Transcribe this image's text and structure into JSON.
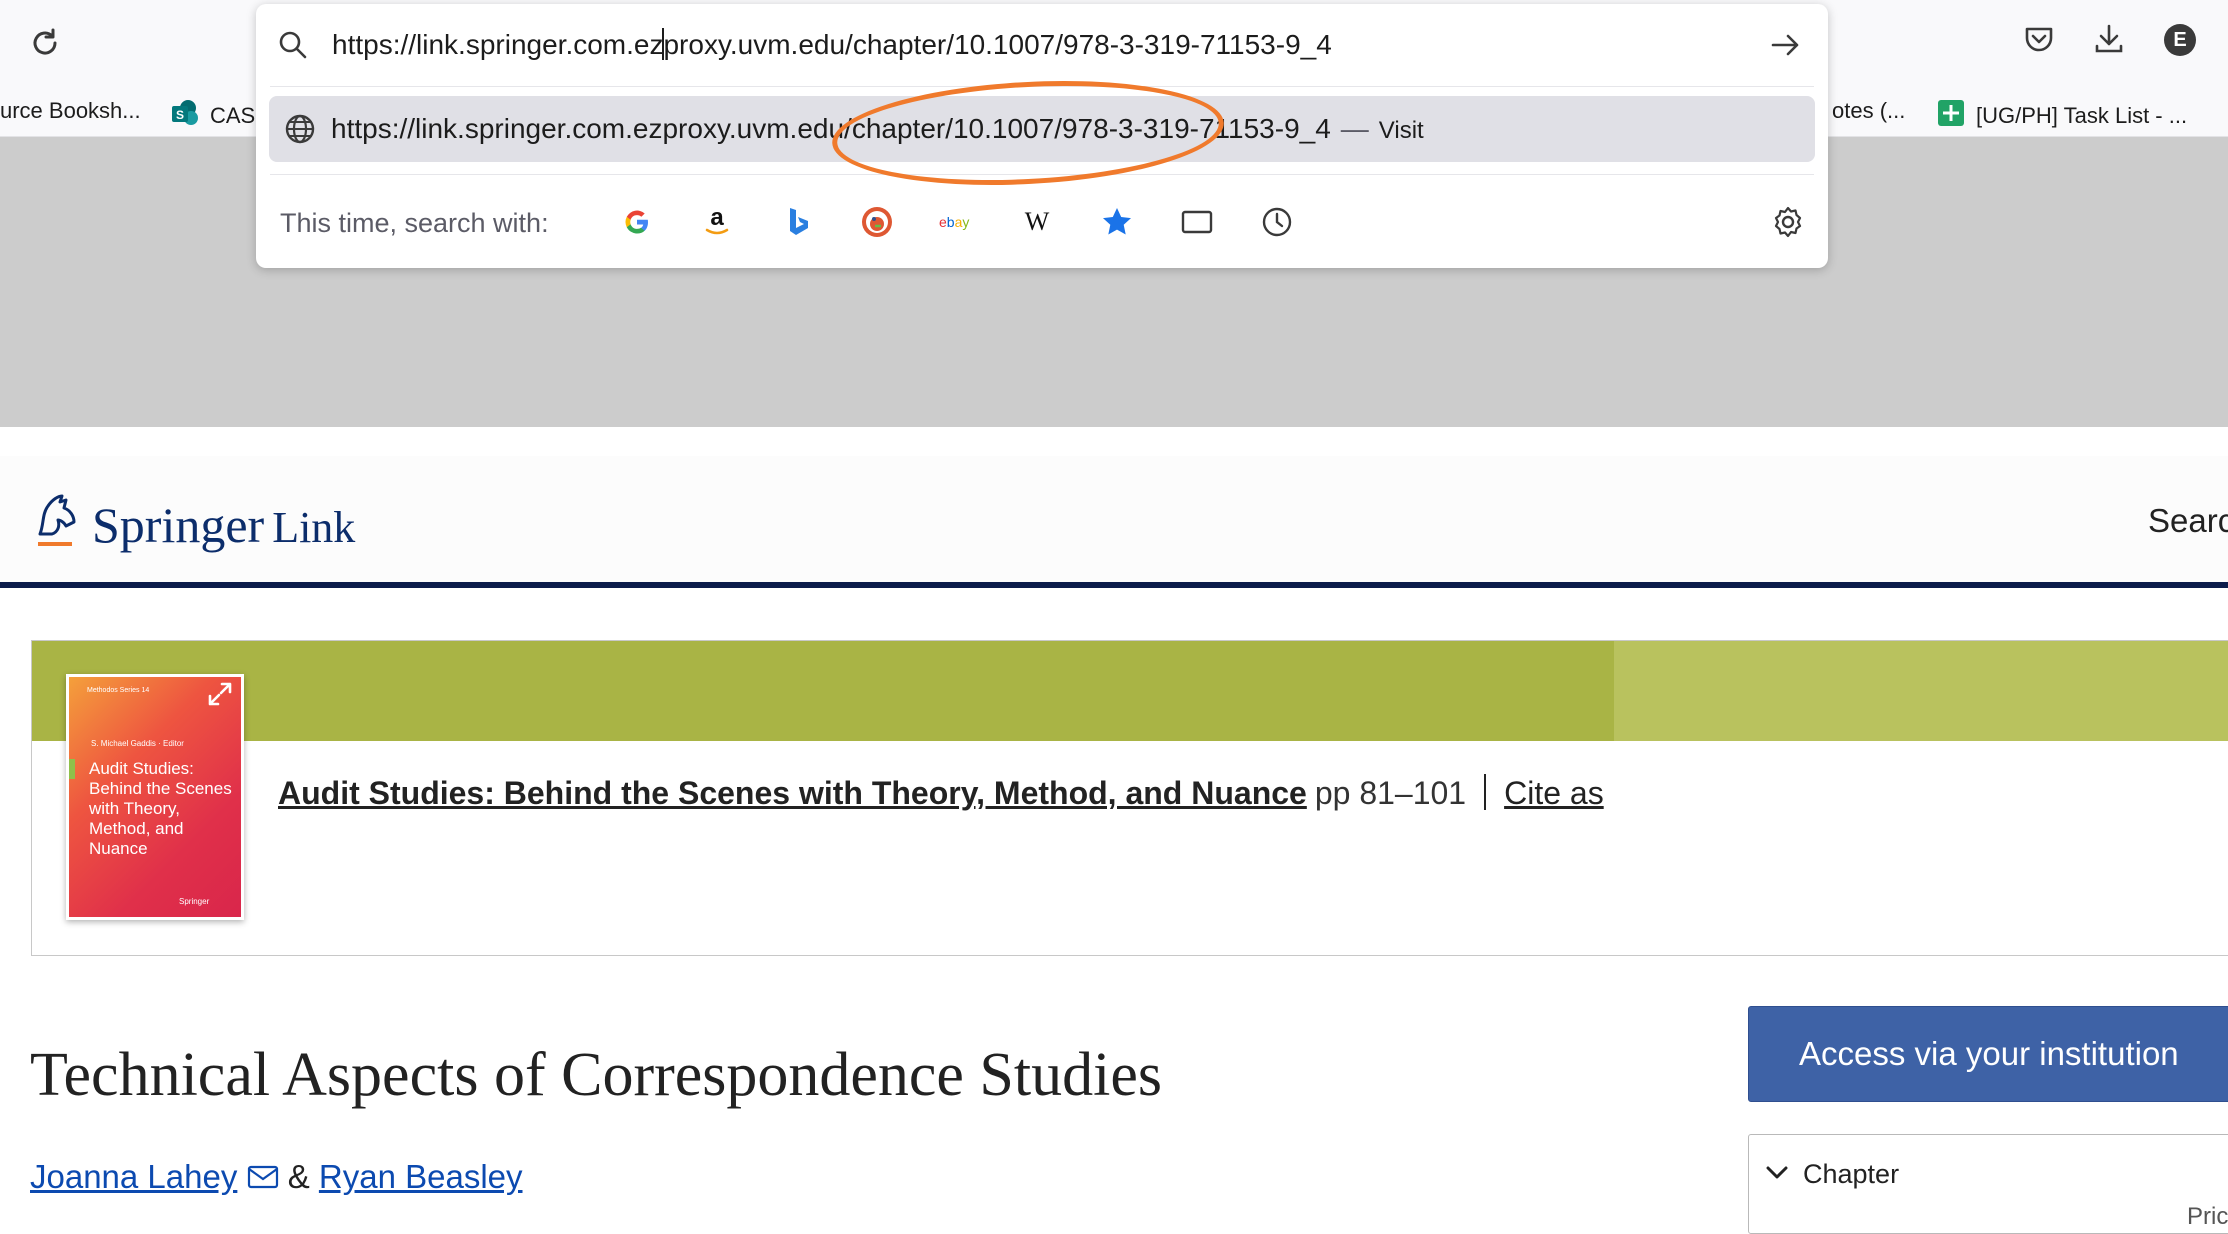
{
  "browser": {
    "url_value": "https://link.springer.com.ezproxy.uvm.edu/chapter/10.1007/978-3-319-71153-9_4",
    "url_before_caret": "https://link.springer.com.ez",
    "url_after_caret": "proxy.uvm.edu/chapter/10.1007/978-3-319-71153-9_4",
    "suggestion_url": "https://link.springer.com.ezproxy.uvm.edu/chapter/10.1007/978-3-319-71153-9_4",
    "suggestion_separator": "—",
    "suggestion_action": "Visit",
    "search_with_label": "This time, search with:",
    "search_engines": [
      "google-icon",
      "amazon-icon",
      "bing-icon",
      "duckduckgo-icon",
      "ebay-icon",
      "wikipedia-icon",
      "bookmarks-star-icon",
      "tabs-icon",
      "history-icon"
    ],
    "profile_initial": "E",
    "annotation_color": "#f07a2c"
  },
  "bookmarks": [
    {
      "label": "urce Booksh..."
    },
    {
      "label": "CAS"
    },
    {
      "label": "otes (..."
    },
    {
      "label": "[UG/PH] Task List - ..."
    }
  ],
  "springer": {
    "logo_main": "Springer",
    "logo_sub": "Link",
    "search_label": "Searc",
    "brand_navy": "#0c1c4b",
    "banner_green": "#a9b445"
  },
  "book": {
    "cover_series": "Methodos Series 14",
    "cover_editor": "S. Michael Gaddis · Editor",
    "cover_title": "Audit Studies: Behind the Scenes with Theory, Method, and Nuance",
    "cover_publisher": "Springer",
    "title": "Audit Studies: Behind the Scenes with Theory, Method, and Nuance",
    "pages": "pp 81–101",
    "cite_label": "Cite as"
  },
  "article": {
    "title": "Technical Aspects of Correspondence Studies",
    "author1": "Joanna Lahey",
    "author_sep": "&",
    "author2": "Ryan Beasley"
  },
  "sidebar": {
    "access_button": "Access via your institution",
    "access_color": "#3e62a6",
    "chapter_label": "Chapter",
    "price_partial": "Pric"
  }
}
